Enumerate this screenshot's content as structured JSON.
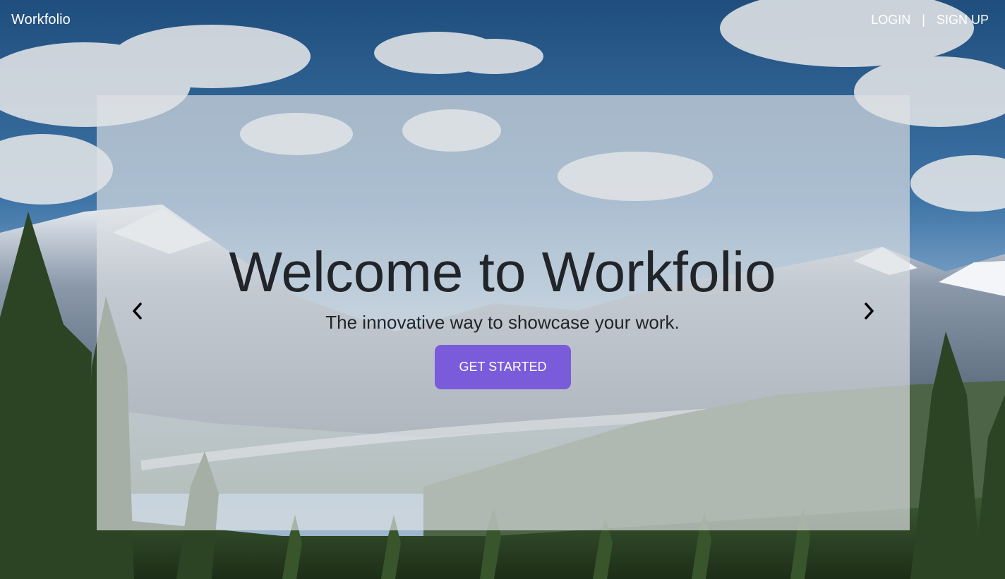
{
  "navbar": {
    "brand": "Workfolio",
    "login_label": "LOGIN",
    "separator": "|",
    "signup_label": "SIGN UP"
  },
  "hero": {
    "title": "Welcome to Workfolio",
    "subtitle": "The innovative way to showcase your work.",
    "cta_label": "GET STARTED"
  },
  "carousel": {
    "prev_icon": "chevron-left-icon",
    "next_icon": "chevron-right-icon"
  },
  "colors": {
    "accent": "#7a5cdb",
    "text_dark": "#212529",
    "nav_text": "#ffffff"
  }
}
